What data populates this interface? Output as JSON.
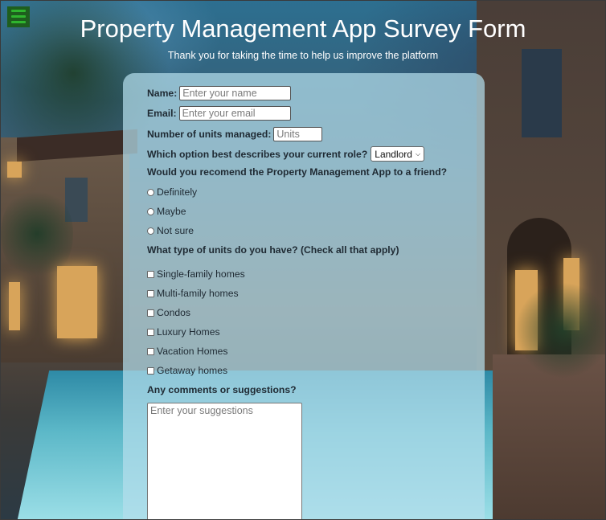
{
  "header": {
    "title": "Property Management App Survey Form",
    "subtitle": "Thank you for taking the time to help us improve the platform"
  },
  "menu": {
    "icon": "hamburger-menu-icon"
  },
  "form": {
    "name": {
      "label": "Name:",
      "placeholder": "Enter your name"
    },
    "email": {
      "label": "Email:",
      "placeholder": "Enter your email"
    },
    "units": {
      "label": "Number of units managed:",
      "placeholder": "Units"
    },
    "role": {
      "label": "Which option best describes your current role?",
      "selected": "Landlord"
    },
    "recommend": {
      "question": "Would you recomend the Property Management App to a friend?",
      "options": [
        "Definitely",
        "Maybe",
        "Not sure"
      ]
    },
    "unit_types": {
      "question": "What type of units do you have? (Check all that apply)",
      "options": [
        "Single-family homes",
        "Multi-family homes",
        "Condos",
        "Luxury Homes",
        "Vacation Homes",
        "Getaway homes"
      ]
    },
    "comments": {
      "label": "Any comments or suggestions?",
      "placeholder": "Enter your suggestions"
    }
  },
  "colors": {
    "card": "#b4deec",
    "menu_button": "#1e5e1e",
    "title_text": "#ffffff"
  }
}
